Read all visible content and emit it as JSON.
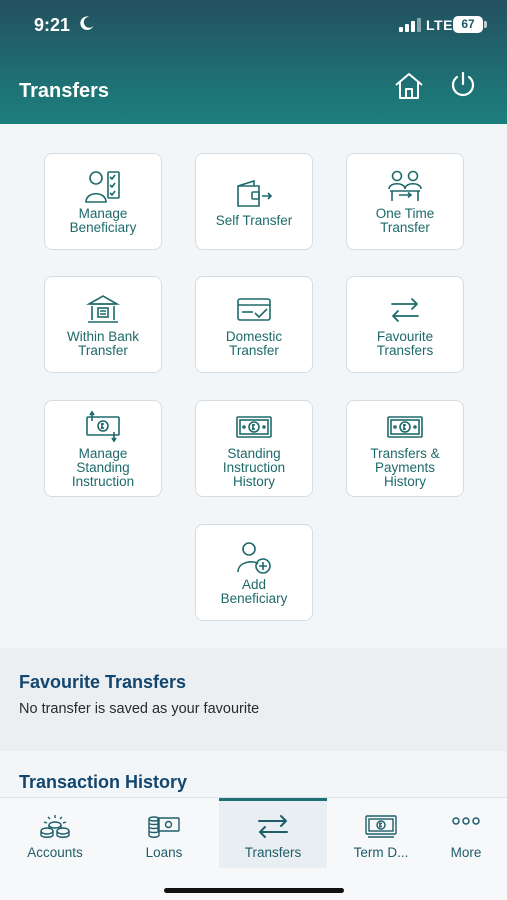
{
  "status_bar": {
    "time": "9:21",
    "network": "LTE",
    "battery": "67"
  },
  "header": {
    "title": "Transfers"
  },
  "tiles": [
    {
      "label": "Manage\nBeneficiary",
      "icon": "user-checklist-icon"
    },
    {
      "label": "Self Transfer",
      "icon": "wallet-transfer-icon"
    },
    {
      "label": "One Time\nTransfer",
      "icon": "two-users-icon"
    },
    {
      "label": "Within Bank\nTransfer",
      "icon": "bank-icon"
    },
    {
      "label": "Domestic\nTransfer",
      "icon": "card-check-icon"
    },
    {
      "label": "Favourite\nTransfers",
      "icon": "swap-arrows-icon"
    },
    {
      "label": "Manage\nStanding\nInstruction",
      "icon": "money-cycle-icon"
    },
    {
      "label": "Standing\nInstruction\nHistory",
      "icon": "banknote-icon"
    },
    {
      "label": "Transfers &\nPayments\nHistory",
      "icon": "banknote-icon"
    },
    {
      "label": "Add\nBeneficiary",
      "icon": "add-user-icon"
    }
  ],
  "favourites": {
    "title": "Favourite Transfers",
    "empty_text": "No transfer is saved as your favourite"
  },
  "history": {
    "title": "Transaction History"
  },
  "tabbar": [
    {
      "label": "Accounts",
      "icon": "coins-stack-icon"
    },
    {
      "label": "Loans",
      "icon": "cash-stack-icon"
    },
    {
      "label": "Transfers",
      "icon": "swap-arrows-icon",
      "active": true
    },
    {
      "label": "Term D...",
      "icon": "banknote-icon"
    },
    {
      "label": "More",
      "icon": "more-dots-icon"
    }
  ]
}
